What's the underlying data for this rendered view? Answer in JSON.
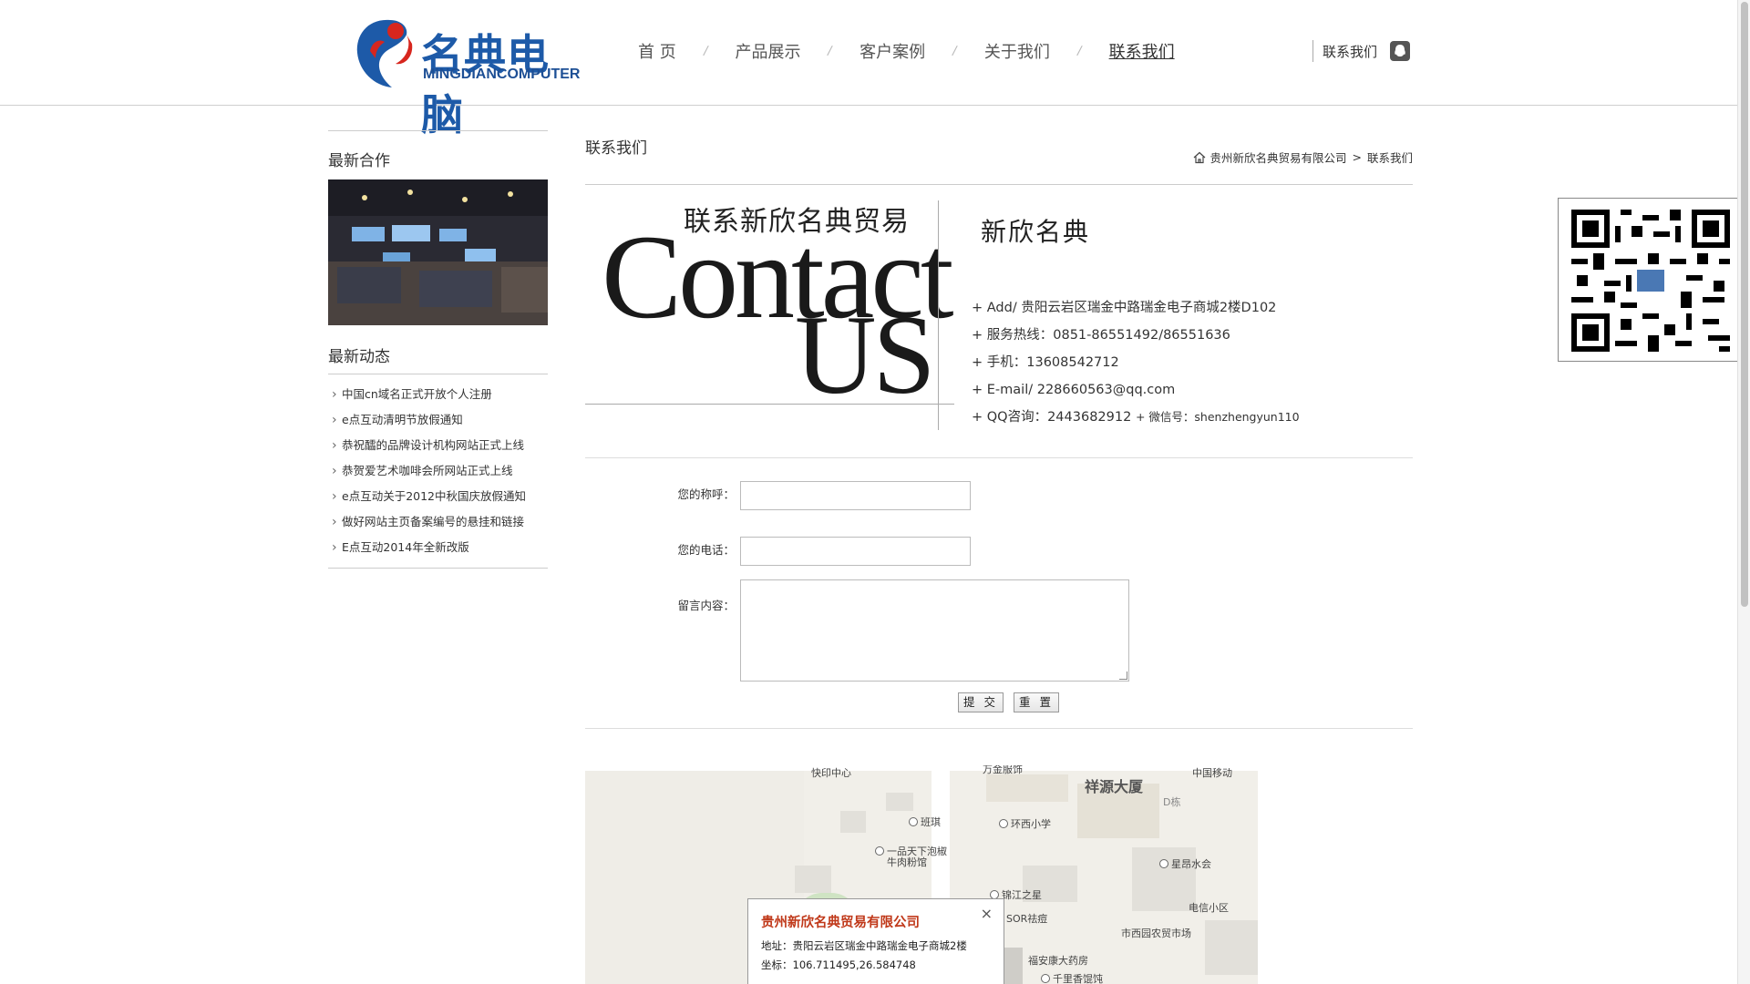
{
  "logo": {
    "name_cn": "名典电脑",
    "name_en": "MINGDIANCOMPUTER"
  },
  "nav": {
    "items": [
      {
        "label": "首 页"
      },
      {
        "label": "产品展示"
      },
      {
        "label": "客户案例"
      },
      {
        "label": "关于我们"
      },
      {
        "label": "联系我们",
        "active": true
      }
    ],
    "separator": "/"
  },
  "header_right": {
    "label": "联系我们",
    "icon": "qq-icon"
  },
  "sidebar": {
    "cooperation_title": "最新合作",
    "news_title": "最新动态",
    "news": [
      "中国cn域名正式开放个人注册",
      "e点互动清明节放假通知",
      "恭祝醽的品牌设计机构网站正式上线",
      "恭贺爱艺术咖啡会所网站正式上线",
      "e点互动关于2012中秋国庆放假通知",
      "做好网站主页备案编号的悬挂和链接",
      "E点互动2014年全新改版"
    ]
  },
  "main": {
    "title": "联系我们",
    "breadcrumb": {
      "home": "贵州新欣名典贸易有限公司",
      "separator": ">",
      "current": "联系我们"
    },
    "contact_image": {
      "cn": "联系新欣名典贸易",
      "big": "Contact",
      "us": "US"
    },
    "company": "新欣名典",
    "info": {
      "address": "+ Add/ 贵阳云岩区瑞金中路瑞金电子商城2楼D102",
      "hotline": "+ 服务热线：0851-86551492/86551636",
      "mobile": "+ 手机：13608542712",
      "email": "+ E-mail/ 228660563@qq.com",
      "qq": "+ QQ咨询：2443682912",
      "wechat_prefix": "+ 微信号：",
      "wechat": "shenzhengyun110"
    },
    "form": {
      "name_label": "您的称呼：",
      "phone_label": "您的电话：",
      "message_label": "留言内容：",
      "submit": "提 交",
      "reset": "重 置"
    },
    "map": {
      "popup_title": "贵州新欣名典贸易有限公司",
      "popup_address": "地址：贵阳云岩区瑞金中路瑞金电子商城2楼",
      "popup_coords": "坐标：106.711495,26.584748",
      "close": "×",
      "labels": [
        "快印中心",
        "万金服饰",
        "祥源大厦",
        "中国移动",
        "D栋",
        "班琪",
        "环西小学",
        "一品天下泡椒",
        "牛肉粉馆",
        "星昂水会",
        "锦江之星",
        "电信小区",
        "市西园农贸市场",
        "SOR祛痘",
        "福安康大药房",
        "千里香馄饨"
      ]
    }
  }
}
